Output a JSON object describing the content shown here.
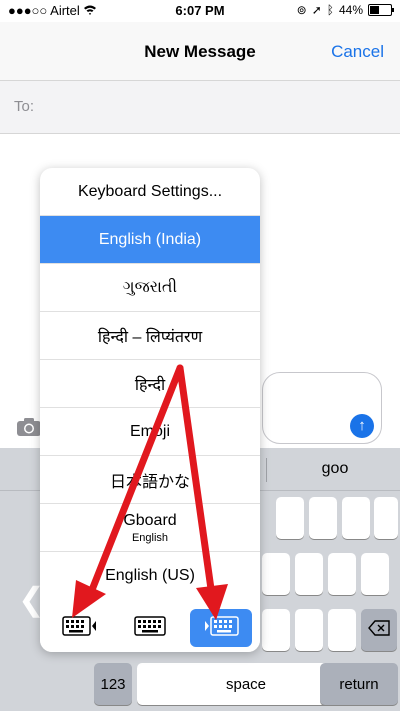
{
  "status_bar": {
    "carrier": "Airtel",
    "time": "6:07 PM",
    "battery": "44%",
    "battery_level": 0.44
  },
  "nav": {
    "title": "New Message",
    "cancel": "Cancel"
  },
  "to_field": {
    "label": "To:"
  },
  "suggestion": {
    "word": "goo"
  },
  "popup": {
    "items": [
      {
        "label": "Keyboard Settings..."
      },
      {
        "label": "English (India)",
        "selected": true
      },
      {
        "label": "ગુજરાતી"
      },
      {
        "label": "हिन्दी – लिप्यंतरण"
      },
      {
        "label": "हिन्दी"
      },
      {
        "label": "Emoji"
      },
      {
        "label": "日本語かな"
      },
      {
        "label": "Gboard",
        "sub": "English"
      },
      {
        "label": "English (US)"
      }
    ]
  },
  "keys": {
    "numbers": "123",
    "space": "space",
    "return": "return"
  },
  "colors": {
    "accent": "#1a73e8",
    "selection": "#3d8bf2",
    "arrow": "#e1181e"
  }
}
